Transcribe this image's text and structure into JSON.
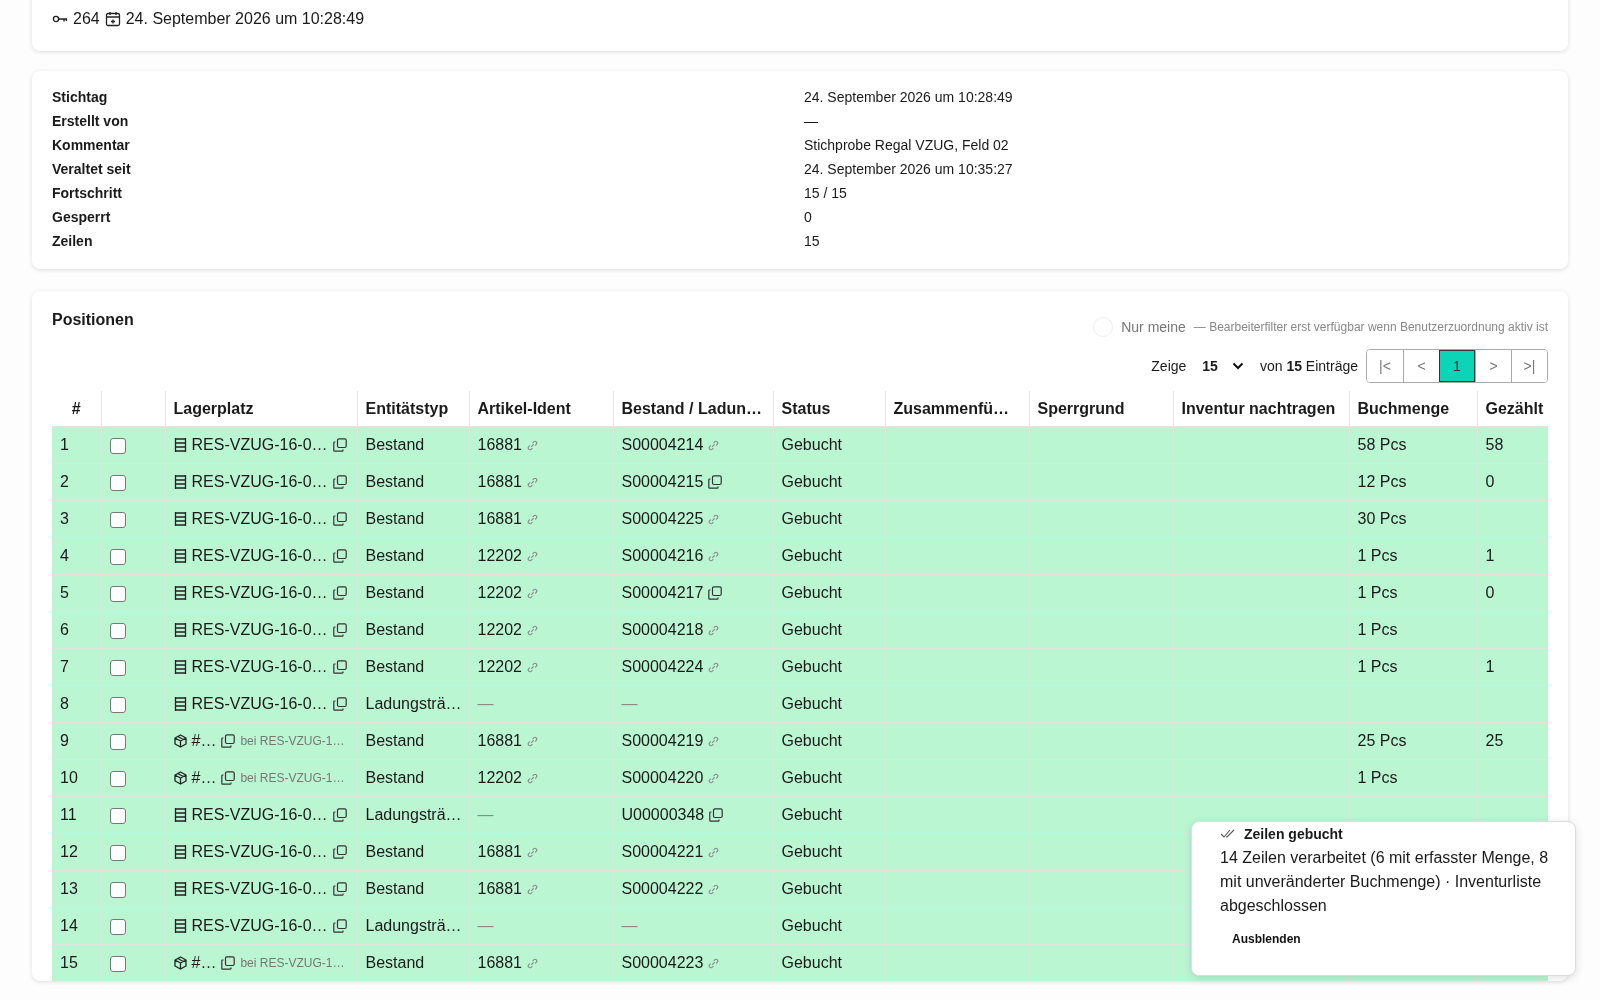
{
  "header": {
    "id": "264",
    "date": "24. September 2026 um 10:28:49"
  },
  "details": [
    {
      "label": "Stichtag",
      "value": "24. September 2026 um 10:28:49"
    },
    {
      "label": "Erstellt von",
      "value": "—"
    },
    {
      "label": "Kommentar",
      "value": "Stichprobe Regal VZUG, Feld 02"
    },
    {
      "label": "Veraltet seit",
      "value": "24. September 2026 um 10:35:27"
    },
    {
      "label": "Fortschritt",
      "value": "15 / 15"
    },
    {
      "label": "Gesperrt",
      "value": "0"
    },
    {
      "label": "Zeilen",
      "value": "15"
    }
  ],
  "positions": {
    "title": "Positionen",
    "filter": {
      "label": "Nur meine",
      "on": false,
      "note": "— Bearbeiterfilter erst verfügbar wenn Benutzerzuordnung aktiv ist"
    },
    "pagination": {
      "show_label": "Zeige",
      "page_size": "15",
      "total_text": "von **15** Einträge",
      "buttons": [
        {
          "label": "|<",
          "selected": false
        },
        {
          "label": "<",
          "selected": false
        },
        {
          "label": "1",
          "selected": true
        },
        {
          "label": ">",
          "selected": false
        },
        {
          "label": ">|",
          "selected": false
        }
      ]
    },
    "columns": [
      "#",
      "",
      "Lagerplatz",
      "Entitätstyp",
      "Artikel-Ident",
      "Bestand / Ladun…",
      "Status",
      "Zusammenfü…",
      "Sperrgrund",
      "Inventur nachtragen",
      "Buchmenge",
      "Gezählt"
    ],
    "rows": [
      {
        "no": "1",
        "checked": false,
        "booked": true,
        "place": {
          "kind": "location",
          "text": "RES-VZUG-16-0…"
        },
        "type": "Bestand",
        "article": {
          "text": "16881",
          "kind": "linked"
        },
        "stock": {
          "text": "S00004214",
          "kind": "linked"
        },
        "status": "Gebucht",
        "book_qty": "58 Pcs",
        "counted": "58"
      },
      {
        "no": "2",
        "checked": false,
        "booked": true,
        "place": {
          "kind": "location",
          "text": "RES-VZUG-16-0…"
        },
        "type": "Bestand",
        "article": {
          "text": "16881",
          "kind": "linked"
        },
        "stock": {
          "text": "S00004215",
          "kind": "copyable"
        },
        "status": "Gebucht",
        "book_qty": "12 Pcs",
        "counted": "0"
      },
      {
        "no": "3",
        "checked": false,
        "booked": true,
        "place": {
          "kind": "location",
          "text": "RES-VZUG-16-0…"
        },
        "type": "Bestand",
        "article": {
          "text": "16881",
          "kind": "linked"
        },
        "stock": {
          "text": "S00004225",
          "kind": "linked"
        },
        "status": "Gebucht",
        "book_qty": "30 Pcs"
      },
      {
        "no": "4",
        "checked": false,
        "booked": true,
        "place": {
          "kind": "location",
          "text": "RES-VZUG-16-0…"
        },
        "type": "Bestand",
        "article": {
          "text": "12202",
          "kind": "linked"
        },
        "stock": {
          "text": "S00004216",
          "kind": "linked"
        },
        "status": "Gebucht",
        "book_qty": "1 Pcs",
        "counted": "1"
      },
      {
        "no": "5",
        "checked": false,
        "booked": true,
        "place": {
          "kind": "location",
          "text": "RES-VZUG-16-0…"
        },
        "type": "Bestand",
        "article": {
          "text": "12202",
          "kind": "linked"
        },
        "stock": {
          "text": "S00004217",
          "kind": "copyable"
        },
        "status": "Gebucht",
        "book_qty": "1 Pcs",
        "counted": "0"
      },
      {
        "no": "6",
        "checked": false,
        "booked": true,
        "place": {
          "kind": "location",
          "text": "RES-VZUG-16-0…"
        },
        "type": "Bestand",
        "article": {
          "text": "12202",
          "kind": "linked"
        },
        "stock": {
          "text": "S00004218",
          "kind": "linked"
        },
        "status": "Gebucht",
        "book_qty": "1 Pcs"
      },
      {
        "no": "7",
        "checked": false,
        "booked": true,
        "place": {
          "kind": "location",
          "text": "RES-VZUG-16-0…"
        },
        "type": "Bestand",
        "article": {
          "text": "12202",
          "kind": "linked"
        },
        "stock": {
          "text": "S00004224",
          "kind": "linked"
        },
        "status": "Gebucht",
        "book_qty": "1 Pcs",
        "counted": "1"
      },
      {
        "no": "8",
        "checked": false,
        "booked": true,
        "place": {
          "kind": "location",
          "text": "RES-VZUG-16-0…"
        },
        "type": "Ladungsträ…",
        "article": {
          "text": "—"
        },
        "stock": {
          "text": "—"
        },
        "status": "Gebucht"
      },
      {
        "no": "9",
        "checked": false,
        "booked": true,
        "place": {
          "kind": "carrier",
          "text": "#…",
          "at": "bei RES-VZUG-1…"
        },
        "type": "Bestand",
        "article": {
          "text": "16881",
          "kind": "linked"
        },
        "stock": {
          "text": "S00004219",
          "kind": "linked"
        },
        "status": "Gebucht",
        "book_qty": "25 Pcs",
        "counted": "25"
      },
      {
        "no": "10",
        "checked": false,
        "booked": true,
        "place": {
          "kind": "carrier",
          "text": "#…",
          "at": "bei RES-VZUG-1…"
        },
        "type": "Bestand",
        "article": {
          "text": "12202",
          "kind": "linked"
        },
        "stock": {
          "text": "S00004220",
          "kind": "linked"
        },
        "status": "Gebucht",
        "book_qty": "1 Pcs"
      },
      {
        "no": "11",
        "checked": false,
        "booked": true,
        "place": {
          "kind": "location",
          "text": "RES-VZUG-16-0…"
        },
        "type": "Ladungsträ…",
        "article": {
          "text": "—"
        },
        "stock": {
          "text": "U00000348",
          "kind": "copyable"
        },
        "status": "Gebucht"
      },
      {
        "no": "12",
        "checked": false,
        "booked": true,
        "place": {
          "kind": "location",
          "text": "RES-VZUG-16-0…"
        },
        "type": "Bestand",
        "article": {
          "text": "16881",
          "kind": "linked"
        },
        "stock": {
          "text": "S00004221",
          "kind": "linked"
        },
        "status": "Gebucht"
      },
      {
        "no": "13",
        "checked": false,
        "booked": true,
        "place": {
          "kind": "location",
          "text": "RES-VZUG-16-0…"
        },
        "type": "Bestand",
        "article": {
          "text": "16881",
          "kind": "linked"
        },
        "stock": {
          "text": "S00004222",
          "kind": "linked"
        },
        "status": "Gebucht"
      },
      {
        "no": "14",
        "checked": false,
        "booked": true,
        "place": {
          "kind": "location",
          "text": "RES-VZUG-16-0…"
        },
        "type": "Ladungsträ…",
        "article": {
          "text": "—"
        },
        "stock": {
          "text": "—"
        },
        "status": "Gebucht"
      },
      {
        "no": "15",
        "checked": false,
        "booked": true,
        "place": {
          "kind": "carrier",
          "text": "#…",
          "at": "bei RES-VZUG-1…"
        },
        "type": "Bestand",
        "article": {
          "text": "16881",
          "kind": "linked"
        },
        "stock": {
          "text": "S00004223",
          "kind": "linked"
        },
        "status": "Gebucht"
      }
    ]
  },
  "toast": {
    "title": "Zeilen gebucht",
    "message": "14 Zeilen verarbeitet (6 mit erfasster Menge, 8 mit unveränderter Buchmenge) · Inventurliste abgeschlossen",
    "action": "Ausblenden"
  }
}
